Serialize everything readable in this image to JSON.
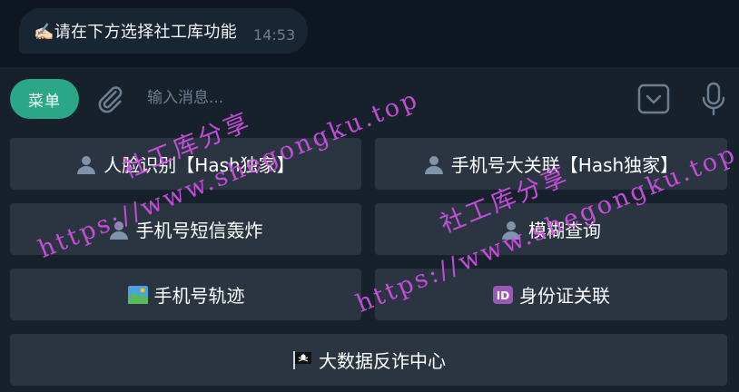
{
  "message": {
    "text": "✍🏻请在下方选择社工库功能",
    "time": "14:53"
  },
  "composer": {
    "menu_label": "菜单",
    "input_placeholder": "输入消息..."
  },
  "keyboard": {
    "buttons": [
      {
        "icon": "person-icon",
        "label": "人脸识别【Hash独家】"
      },
      {
        "icon": "person-icon",
        "label": "手机号大关联【Hash独家】"
      },
      {
        "icon": "person-icon",
        "label": "手机号短信轰炸"
      },
      {
        "icon": "person-icon",
        "label": "模糊查询"
      },
      {
        "icon": "map-icon",
        "label": "手机号轨迹"
      },
      {
        "icon": "id-icon",
        "label": "身份证关联"
      },
      {
        "icon": "pirate-flag-icon",
        "label": "大数据反诈中心"
      }
    ]
  },
  "watermarks": [
    {
      "site": "社工库分享",
      "url": "https://www.shegongku.top"
    },
    {
      "site": "社工库分享",
      "url": "https://www.shegongku.top"
    }
  ],
  "colors": {
    "chat_background": "#0e1621",
    "bubble": "#182533",
    "panel": "#17212b",
    "button": "#2b3541",
    "accent": "#2aa786",
    "watermark": "#d050e6"
  }
}
